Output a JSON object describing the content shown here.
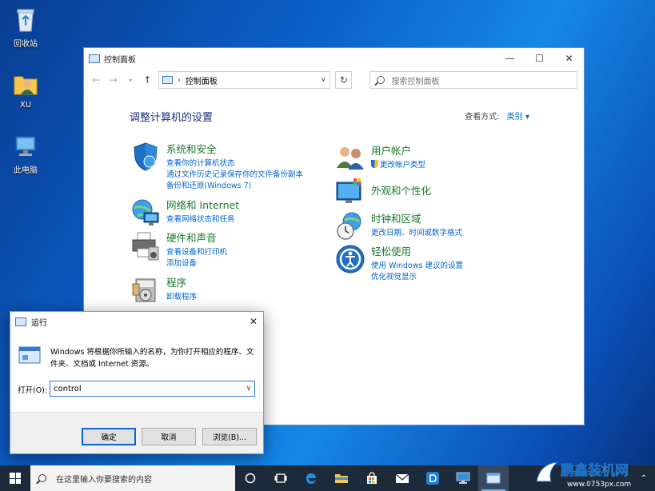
{
  "desktop": {
    "icons": [
      {
        "label": "回收站"
      },
      {
        "label": "XU"
      },
      {
        "label": "此电脑"
      }
    ]
  },
  "control_panel": {
    "title": "控制面板",
    "address": {
      "crumb": "控制面板"
    },
    "search_placeholder": "搜索控制面板",
    "heading": "调整计算机的设置",
    "view_label": "查看方式:",
    "view_value": "类别 ▾",
    "categories": [
      {
        "title": "系统和安全",
        "links": [
          "查看你的计算机状态",
          "通过文件历史记录保存你的文件备份副本",
          "备份和还原(Windows 7)"
        ]
      },
      {
        "title": "网络和 Internet",
        "links": [
          "查看网络状态和任务"
        ]
      },
      {
        "title": "硬件和声音",
        "links": [
          "查看设备和打印机",
          "添加设备"
        ]
      },
      {
        "title": "程序",
        "links": [
          "卸载程序"
        ]
      },
      {
        "title": "用户帐户",
        "links": [
          "更改帐户类型"
        ]
      },
      {
        "title": "外观和个性化",
        "links": []
      },
      {
        "title": "时钟和区域",
        "links": [
          "更改日期、时间或数字格式"
        ]
      },
      {
        "title": "轻松使用",
        "links": [
          "使用 Windows 建议的设置",
          "优化视觉显示"
        ]
      }
    ]
  },
  "run_dialog": {
    "title": "运行",
    "description": "Windows 将根据你所输入的名称，为你打开相应的程序、文件夹、文档或 Internet 资源。",
    "open_label": "打开(O):",
    "input_value": "control",
    "buttons": {
      "ok": "确定",
      "cancel": "取消",
      "browse": "浏览(B)..."
    }
  },
  "taskbar": {
    "search_placeholder": "在这里输入你要搜索的内容"
  },
  "watermark": {
    "brand": "鹏鑫装机网",
    "url": "www.0753px.com"
  },
  "colors": {
    "accent": "#0066cc",
    "category_title": "#1b7a2a",
    "heading": "#1e3287",
    "taskbar": "#1d2a3a"
  }
}
